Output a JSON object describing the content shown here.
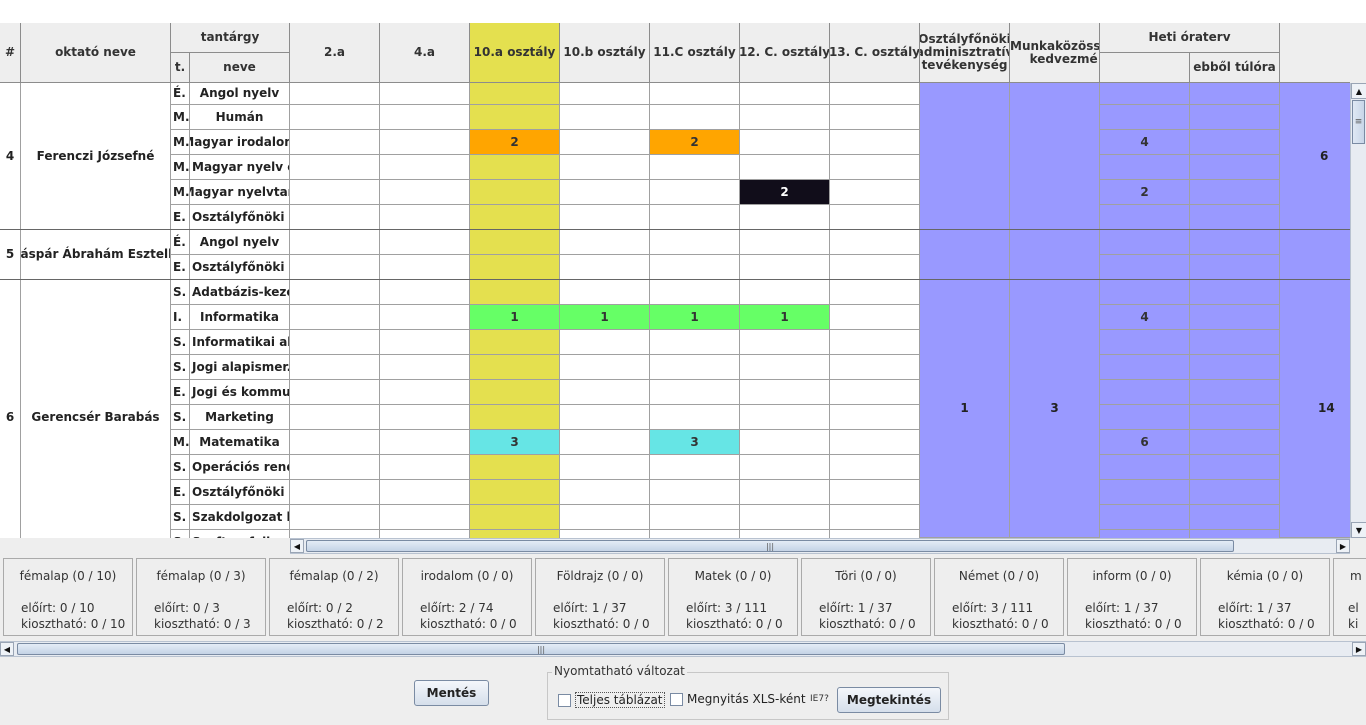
{
  "header": {
    "num": "#",
    "teacher": "oktató neve",
    "subject_group": "tantárgy",
    "subject_t": "t.",
    "subject_name": "neve",
    "classes": [
      "2.a",
      "4.a",
      "10.a osztály",
      "10.b osztály",
      "11.C osztály",
      "12. C. osztály",
      "13. C. osztály"
    ],
    "admin": "Osztályfőnöki adminisztratív tevékenység",
    "munkakozosseg": "Munkaközösség kedvezmé",
    "heti": "Heti óraterv",
    "ebbol": "ebből túlóra",
    "he": "He"
  },
  "colors": {
    "highlight_column": "#e4e04f",
    "purple": "#9999ff",
    "orange": "#ffa500",
    "dark": "#110d1a",
    "green": "#66ff66",
    "cyan": "#66e5e5"
  },
  "teachers": [
    {
      "num": "4",
      "name": "Ferenczi Józsefné",
      "admin": "",
      "mk": "",
      "he": "6",
      "rows": [
        {
          "t": "É.",
          "name": "Angol nyelv",
          "cells": [
            "",
            "",
            "",
            "",
            "",
            "",
            ""
          ],
          "heti": "",
          "tul": ""
        },
        {
          "t": "M.",
          "name": "Humán",
          "cells": [
            "",
            "",
            "",
            "",
            "",
            "",
            ""
          ],
          "heti": "",
          "tul": ""
        },
        {
          "t": "M.",
          "name": "Magyar irodalom",
          "cells": [
            "",
            "",
            "2",
            "",
            "2",
            "",
            ""
          ],
          "heti": "4",
          "tul": ""
        },
        {
          "t": "M.",
          "name": "Magyar nyelv é...",
          "cells": [
            "",
            "",
            "",
            "",
            "",
            "",
            ""
          ],
          "heti": "",
          "tul": ""
        },
        {
          "t": "M.",
          "name": "Magyar nyelvtan",
          "cells": [
            "",
            "",
            "",
            "",
            "",
            "2",
            ""
          ],
          "heti": "2",
          "tul": ""
        },
        {
          "t": "E.",
          "name": "Osztályfőnöki ó...",
          "cells": [
            "",
            "",
            "",
            "",
            "",
            "",
            ""
          ],
          "heti": "",
          "tul": ""
        }
      ]
    },
    {
      "num": "5",
      "name": "Gáspár Ábrahám Esztella",
      "admin": "",
      "mk": "",
      "he": "",
      "rows": [
        {
          "t": "É.",
          "name": "Angol nyelv",
          "cells": [
            "",
            "",
            "",
            "",
            "",
            "",
            ""
          ],
          "heti": "",
          "tul": ""
        },
        {
          "t": "E.",
          "name": "Osztályfőnöki ó...",
          "cells": [
            "",
            "",
            "",
            "",
            "",
            "",
            ""
          ],
          "heti": "",
          "tul": ""
        }
      ]
    },
    {
      "num": "6",
      "name": "Gerencsér Barabás",
      "admin": "1",
      "mk": "3",
      "he": "14",
      "rows": [
        {
          "t": "S.",
          "name": "Adatbázis-keze...",
          "cells": [
            "",
            "",
            "",
            "",
            "",
            "",
            ""
          ],
          "heti": "",
          "tul": ""
        },
        {
          "t": "I.",
          "name": "Informatika",
          "cells": [
            "",
            "",
            "1",
            "1",
            "1",
            "1",
            ""
          ],
          "heti": "4",
          "tul": ""
        },
        {
          "t": "S.",
          "name": "Informatikai ala...",
          "cells": [
            "",
            "",
            "",
            "",
            "",
            "",
            ""
          ],
          "heti": "",
          "tul": ""
        },
        {
          "t": "S.",
          "name": "Jogi alapismer...",
          "cells": [
            "",
            "",
            "",
            "",
            "",
            "",
            ""
          ],
          "heti": "",
          "tul": ""
        },
        {
          "t": "E.",
          "name": "Jogi és kommu...",
          "cells": [
            "",
            "",
            "",
            "",
            "",
            "",
            ""
          ],
          "heti": "",
          "tul": ""
        },
        {
          "t": "S.",
          "name": "Marketing",
          "cells": [
            "",
            "",
            "",
            "",
            "",
            "",
            ""
          ],
          "heti": "",
          "tul": ""
        },
        {
          "t": "M.",
          "name": "Matematika",
          "cells": [
            "",
            "",
            "3",
            "",
            "3",
            "",
            ""
          ],
          "heti": "6",
          "tul": ""
        },
        {
          "t": "S.",
          "name": "Operációs rend...",
          "cells": [
            "",
            "",
            "",
            "",
            "",
            "",
            ""
          ],
          "heti": "",
          "tul": ""
        },
        {
          "t": "E.",
          "name": "Osztályfőnöki ó...",
          "cells": [
            "",
            "",
            "",
            "",
            "",
            "",
            ""
          ],
          "heti": "",
          "tul": ""
        },
        {
          "t": "S.",
          "name": "Szakdolgozat k...",
          "cells": [
            "",
            "",
            "",
            "",
            "",
            "",
            ""
          ],
          "heti": "",
          "tul": ""
        },
        {
          "t": "S.",
          "name": "Szoftverfejlesz...",
          "cells": [
            "",
            "",
            "",
            "",
            "",
            "",
            ""
          ],
          "heti": "",
          "tul": ""
        }
      ]
    }
  ],
  "cell_colors": {
    "0-2-2": "orange",
    "0-2-4": "orange",
    "0-4-5": "dark",
    "2-1-2": "green",
    "2-1-3": "green",
    "2-1-4": "green",
    "2-1-5": "green",
    "2-6-2": "cyan",
    "2-6-4": "cyan"
  },
  "cards": [
    {
      "title": "fémalap (0 / 10)",
      "eloirt": "előírt: 0 / 10",
      "kioszthato": "kiosztható: 0 / 10"
    },
    {
      "title": "fémalap (0 / 3)",
      "eloirt": "előírt: 0 / 3",
      "kioszthato": "kiosztható: 0 / 3"
    },
    {
      "title": "fémalap (0 / 2)",
      "eloirt": "előírt: 0 / 2",
      "kioszthato": "kiosztható: 0 / 2"
    },
    {
      "title": "irodalom (0 / 0)",
      "eloirt": "előírt: 2 / 74",
      "kioszthato": "kiosztható: 0 / 0"
    },
    {
      "title": "Földrajz (0 / 0)",
      "eloirt": "előírt: 1 / 37",
      "kioszthato": "kiosztható: 0 / 0"
    },
    {
      "title": "Matek (0 / 0)",
      "eloirt": "előírt: 3 / 111",
      "kioszthato": "kiosztható: 0 / 0"
    },
    {
      "title": "Töri (0 / 0)",
      "eloirt": "előírt: 1 / 37",
      "kioszthato": "kiosztható: 0 / 0"
    },
    {
      "title": "Német (0 / 0)",
      "eloirt": "előírt: 3 / 111",
      "kioszthato": "kiosztható: 0 / 0"
    },
    {
      "title": "inform (0 / 0)",
      "eloirt": "előírt: 1 / 37",
      "kioszthato": "kiosztható: 0 / 0"
    },
    {
      "title": "kémia (0 / 0)",
      "eloirt": "előírt: 1 / 37",
      "kioszthato": "kiosztható: 0 / 0"
    },
    {
      "title": "m",
      "eloirt": "el",
      "kioszthato": "ki"
    }
  ],
  "controls": {
    "save": "Mentés",
    "group_title": "Nyomtatható változat",
    "full_table": "Teljes táblázat",
    "open_xls": "Megnyitás XLS-ként",
    "ie7": "IE7?",
    "preview": "Megtekintés"
  }
}
